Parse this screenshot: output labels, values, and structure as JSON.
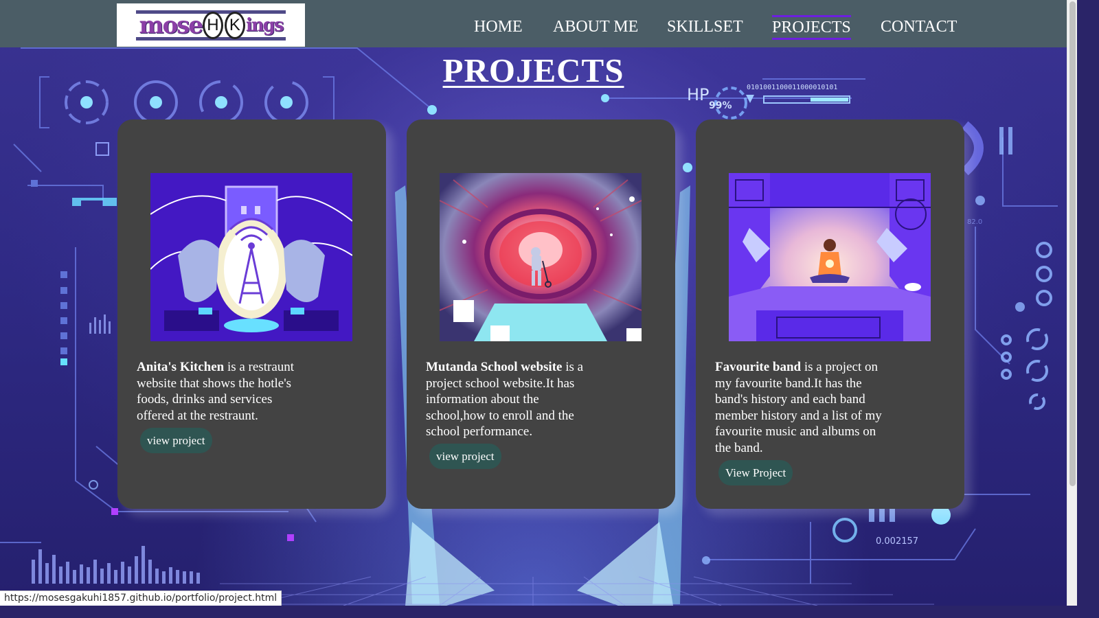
{
  "colors": {
    "navbar": "#4b5d66",
    "active_underline": "#6d1fe0",
    "card": "#434343",
    "button": "#2f5552",
    "background": "#2f2a85"
  },
  "logo": {
    "left_word": "mose",
    "letter_1": "H",
    "letter_2": "K",
    "right_word": "ings"
  },
  "nav": {
    "items": [
      {
        "label": "HOME",
        "active": false
      },
      {
        "label": "ABOUT ME",
        "active": false
      },
      {
        "label": "SKILLSET",
        "active": false
      },
      {
        "label": "PROJECTS",
        "active": true
      },
      {
        "label": "CONTACT",
        "active": false
      }
    ]
  },
  "page": {
    "title": "PROJECTS"
  },
  "background_hud": {
    "hp_label": "HP",
    "hp_percent": "99%",
    "binary": "0101001100011000010101",
    "counter": "0.002157",
    "small_code": "82.0"
  },
  "projects": [
    {
      "title": "Anita's Kitchen",
      "description": " is a restraunt website that shows the hotle's foods, drinks and services offered at the restraunt.",
      "button": "view project",
      "image_icon": "radio-tower-illustration"
    },
    {
      "title": "Mutanda School website",
      "description": " is a project school website.It has information about the school,how to enroll and the school performance.",
      "button": "view project",
      "image_icon": "robot-portal-illustration"
    },
    {
      "title": "Favourite band",
      "description": " is a project on my favourite band.It has the band's history and each band member history and a list of my favourite music and albums on the band.",
      "button": "View Project",
      "image_icon": "meditating-man-illustration"
    }
  ],
  "statusbar": {
    "url": "https://mosesgakuhi1857.github.io/portfolio/project.html"
  }
}
